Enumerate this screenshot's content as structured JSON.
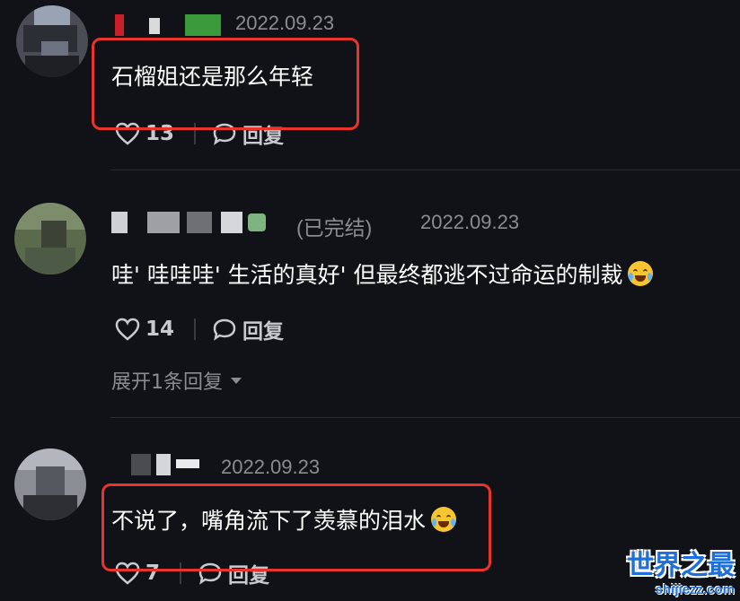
{
  "comments": [
    {
      "author_status": "",
      "date": "2022.09.23",
      "text": "石榴姐还是那么年轻",
      "likes": "13",
      "reply_label": "回复",
      "expand_label": ""
    },
    {
      "author_status": "(已完结)",
      "date": "2022.09.23",
      "text": "哇' 哇哇哇' 生活的真好' 但最终都逃不过命运的制裁",
      "likes": "14",
      "reply_label": "回复",
      "expand_label": "展开1条回复"
    },
    {
      "author_status": "",
      "date": "2022.09.23",
      "text": "不说了，嘴角流下了羡慕的泪水",
      "likes": "7",
      "reply_label": "回复",
      "expand_label": ""
    }
  ],
  "watermark": {
    "title": "世界之最",
    "domain": "shijiezz.com"
  },
  "colors": {
    "background": "#111217",
    "highlight": "#e8342b",
    "muted_text": "#8a8c93",
    "watermark": "#1e6fd8"
  },
  "icons": [
    "heart-icon",
    "comment-bubble-icon",
    "chevron-down-icon",
    "laughing-crying-emoji",
    "crying-emoji"
  ]
}
